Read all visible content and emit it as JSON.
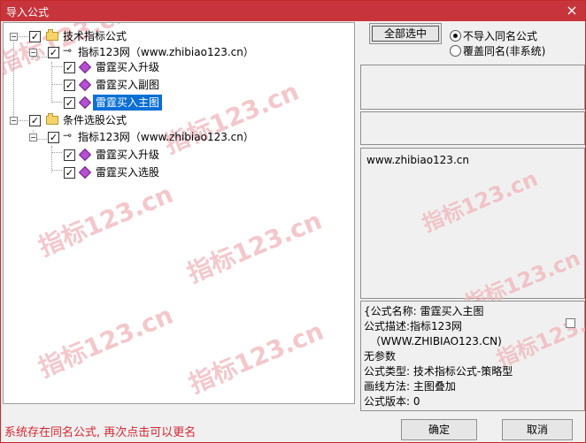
{
  "window": {
    "title": "导入公式",
    "close_glyph": "×"
  },
  "tree": {
    "groups": [
      {
        "label": "技术指标公式",
        "provider": "指标123网（www.zhibiao123.cn）",
        "items": [
          "雷霆买入升级",
          "雷霆买入副图",
          "雷霆买入主图"
        ]
      },
      {
        "label": "条件选股公式",
        "provider": "指标123网（www.zhibiao123.cn）",
        "items": [
          "雷霆买入升级",
          "雷霆买入选股"
        ]
      }
    ]
  },
  "right_panel": {
    "select_all_button": "全部选中",
    "radio_options": [
      "不导入同名公式",
      "覆盖同名(非系统)"
    ],
    "url_text": "www.zhibiao123.cn",
    "details": [
      "{公式名称: 雷霆买入主图",
      "公式描述:指标123网",
      "（WWW.ZHIBIAO123.CN)",
      "无参数",
      "公式类型: 技术指标公式-策略型",
      "画线方法: 主图叠加",
      "公式版本: 0"
    ]
  },
  "footer": {
    "status": "系统存在同名公式, 再次点击可以更名",
    "ok_button": "确定",
    "cancel_button": "取消"
  },
  "watermark": {
    "text": "指标123.cn",
    "color": "#f1b5ba"
  },
  "colors": {
    "titlebar": "#c7343c",
    "status_text": "#d62832",
    "selected": "#0a6fd6"
  }
}
